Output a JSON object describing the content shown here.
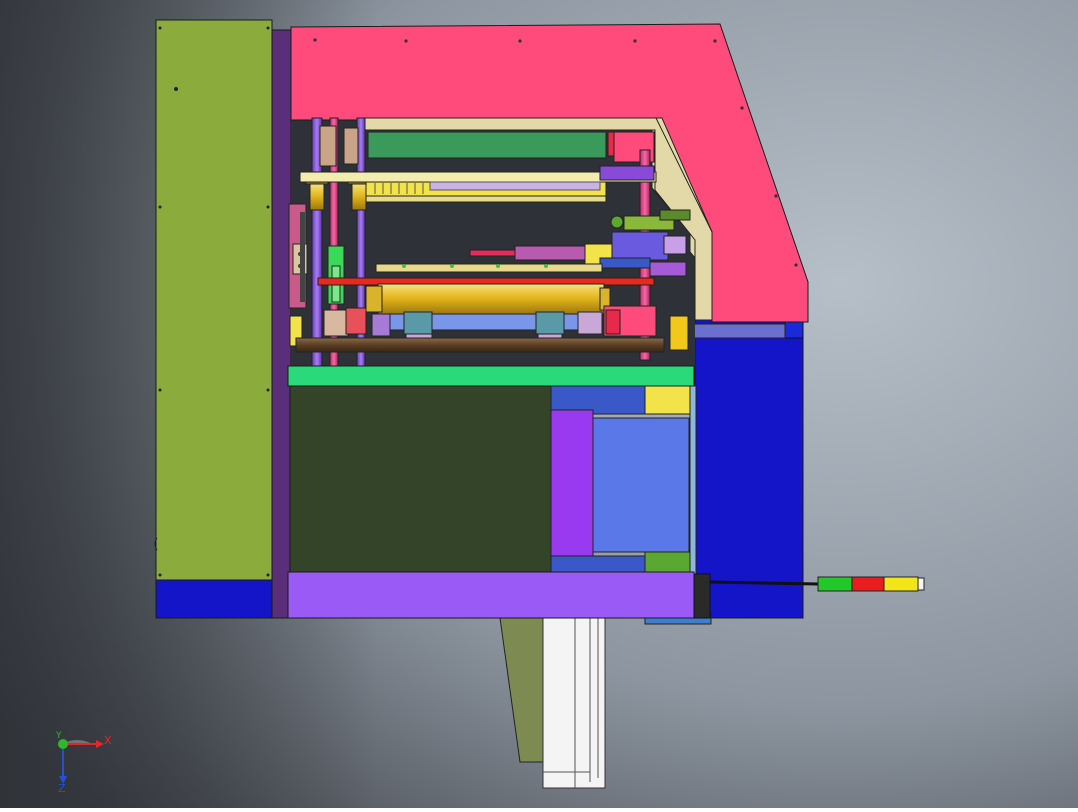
{
  "viewport": {
    "background_top": "#9fa9b2",
    "background_bottom": "#3a3d42"
  },
  "triad": {
    "x_label": "X",
    "y_label": "Y",
    "z_label": "Z",
    "x_color": "#e8242a",
    "y_color": "#2eb82e",
    "z_color": "#2450d8"
  },
  "colors": {
    "olive_panel": "#8bac3c",
    "navy": "#1414c8",
    "dark_purple": "#5a2e78",
    "pink_hood": "#ff4a7c",
    "cream": "#e3d9a8",
    "bright_green": "#29d97a",
    "dark_green": "#334429",
    "violet": "#9a5af5",
    "blue_block": "#5a78e8",
    "yellow": "#f2e34a",
    "gold": "#e8c21c",
    "brown": "#6b4a2c"
  },
  "signal_tower": {
    "segments": [
      "green",
      "red",
      "yellow"
    ],
    "segment_colors": [
      "#22c82a",
      "#e81e1e",
      "#f2e61a"
    ]
  }
}
